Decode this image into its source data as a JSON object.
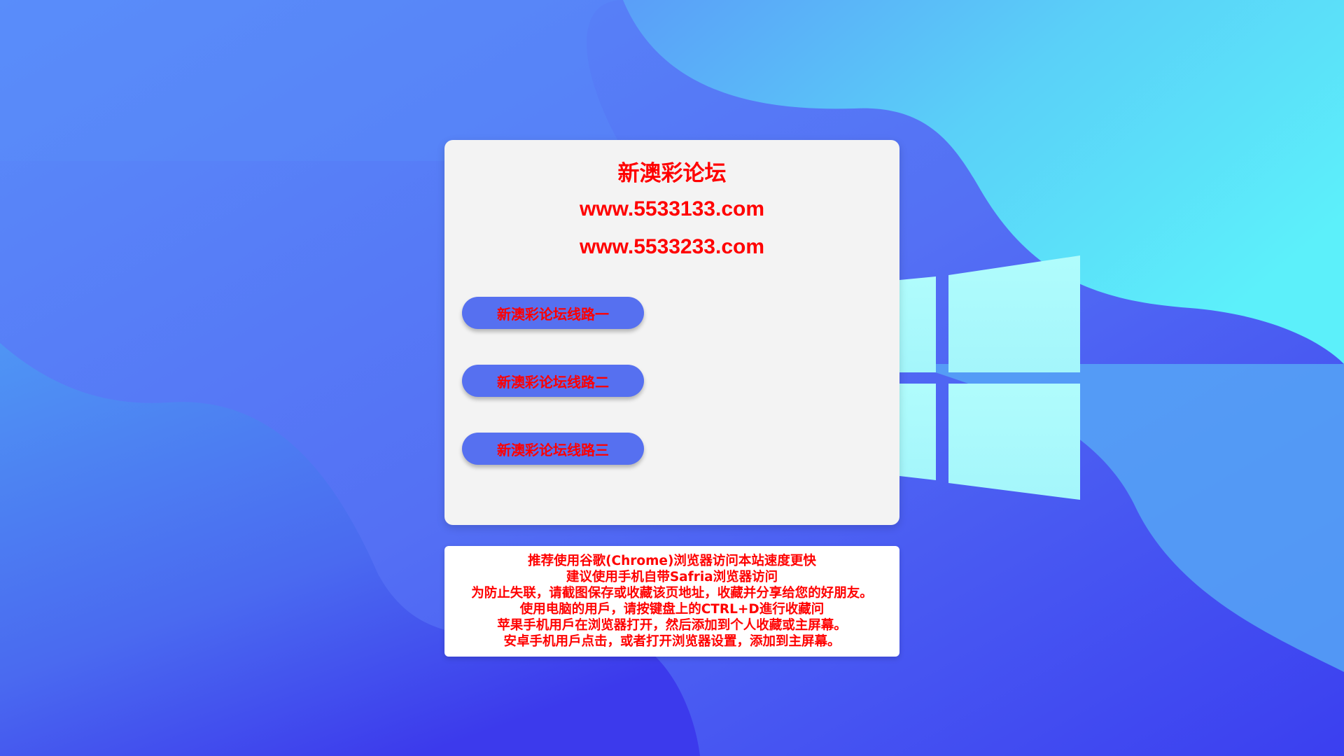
{
  "colors": {
    "background_blue": "#4a63f2",
    "background_cyan": "#5ae8f8",
    "card_bg": "#f3f3f3",
    "text_red": "#ff0000",
    "button_blue": "#5670f0"
  },
  "card": {
    "title": "新澳彩论坛",
    "urls": [
      "www.5533133.com",
      "www.5533233.com"
    ],
    "buttons": [
      {
        "label": "新澳彩论坛线路一"
      },
      {
        "label": "新澳彩论坛线路二"
      },
      {
        "label": "新澳彩论坛线路三"
      }
    ]
  },
  "notice": {
    "lines": [
      "推荐使用谷歌(Chrome)浏览器访问本站速度更快",
      "建议使用手机自带Safria浏览器访问",
      "为防止失联，请截图保存或收藏该页地址，收藏并分享给您的好朋友。",
      "使用电脑的用戶，请按键盘上的CTRL+D進行收藏问",
      "苹果手机用戶在浏览器打开，然后添加到个人收藏或主屏幕。",
      "安卓手机用戶点击，或者打开浏览器设置，添加到主屏幕。"
    ]
  },
  "background": {
    "logo_icon": "windows-logo-icon"
  }
}
